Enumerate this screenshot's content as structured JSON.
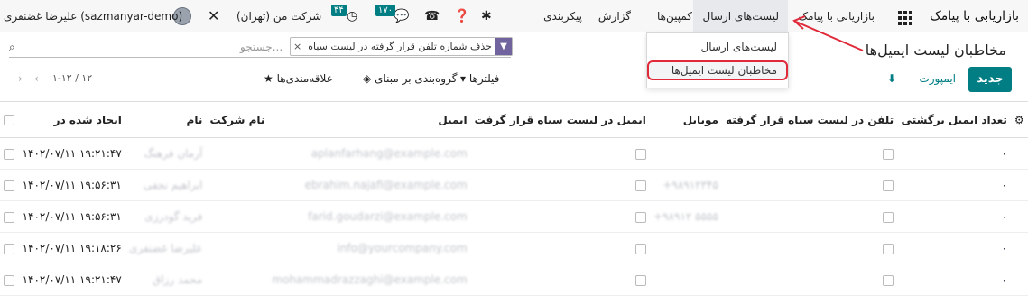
{
  "topbar": {
    "brand": "بازاریابی با پیامک",
    "menu": [
      "بازاریابی با پیامک",
      "لیست‌های ارسال",
      "کمپین‌ها",
      "گزارش",
      "پیکربندی"
    ],
    "activity_count": "۱۷۰",
    "clock_count": "۴۴",
    "company": "شرکت من (تهران)",
    "user": "علیرضا غضنفری (sazmanyar-demo)"
  },
  "dropdown": {
    "items": [
      "لیست‌های ارسال",
      "مخاطبان لیست ایمیل‌ها"
    ]
  },
  "page": {
    "title": "مخاطبان لیست ایمیل‌ها",
    "new_label": "جدید",
    "import_label": "ایمپورت"
  },
  "search": {
    "facet": "حذف شماره تلفن قرار گرفته در لیست سیاه",
    "placeholder": "جستجو..."
  },
  "filters": {
    "filters_label": "فیلترها",
    "group_label": "گروه‌بندی بر مبنای",
    "fav_label": "علاقه‌مندی‌ها"
  },
  "pager": {
    "text": "۱-۱۲ / ۱۲"
  },
  "table": {
    "columns": [
      "ایجاد شده در",
      "نام",
      "نام شرکت",
      "ایمیل",
      "ایمیل در لیست سیاه قرار گرفت",
      "موبایل",
      "تلفن در لیست سیاه قرار گرفته",
      "تعداد ایمیل برگشتی"
    ],
    "rows": [
      {
        "date": "۱۴۰۲/۰۷/۱۱ ۱۹:۲۱:۴۷",
        "name": "آرمان فرهنگ",
        "email": "aplanfarhang@example.com",
        "mobile": "",
        "bounce": "۰"
      },
      {
        "date": "۱۴۰۲/۰۷/۱۱ ۱۹:۵۶:۳۱",
        "name": "ابراهیم نجفی",
        "email": "ebrahim.najafi@example.com",
        "mobile": "+۹۸۹۱۲۳۴۵",
        "bounce": "۰"
      },
      {
        "date": "۱۴۰۲/۰۷/۱۱ ۱۹:۵۶:۳۱",
        "name": "فرید گودرزی",
        "email": "farid.goudarzi@example.com",
        "mobile": "+۹۸۹۱۲ ۵۵۵۵",
        "bounce": "۰"
      },
      {
        "date": "۱۴۰۲/۰۷/۱۱ ۱۹:۱۸:۲۶",
        "name": "علیرضا غضنفری",
        "email": "info@yourcompany.com",
        "mobile": "",
        "bounce": "۰"
      },
      {
        "date": "۱۴۰۲/۰۷/۱۱ ۱۹:۲۱:۴۷",
        "name": "محمد رزاق",
        "email": "mohammadrazzaghi@example.com",
        "mobile": "",
        "bounce": "۰"
      }
    ]
  }
}
